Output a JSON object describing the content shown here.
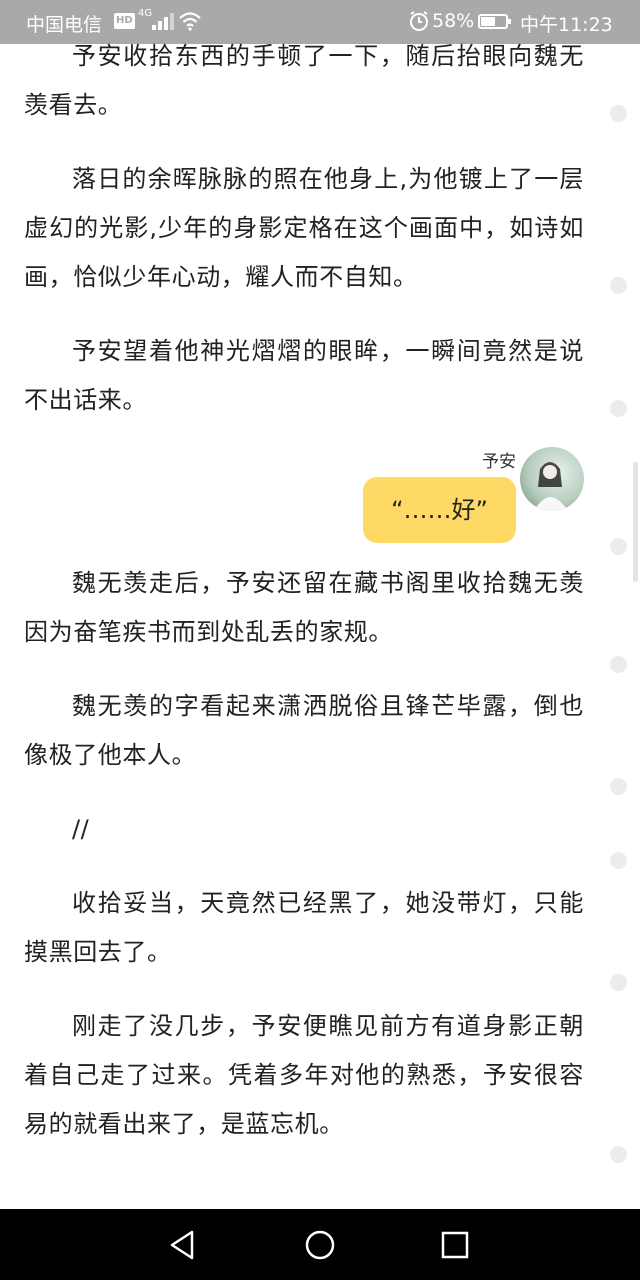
{
  "status_bar": {
    "carrier": "中国电信",
    "hd_badge": "HD",
    "network": "4G",
    "battery_percent": "58%",
    "battery_level": 0.58,
    "time": "中午11:23"
  },
  "paragraphs": {
    "p1": "予安收拾东西的手顿了一下，随后抬眼向魏无羡看去。",
    "p2": "落日的余晖脉脉的照在他身上,为他镀上了一层虚幻的光影,少年的身影定格在这个画面中，如诗如画，恰似少年心动，耀人而不自知。",
    "p3": "予安望着他神光熠熠的眼眸，一瞬间竟然是说不出话来。",
    "p4": "魏无羡走后，予安还留在藏书阁里收拾魏无羡因为奋笔疾书而到处乱丢的家规。",
    "p5": "魏无羡的字看起来潇洒脱俗且锋芒毕露，倒也像极了他本人。",
    "p6": "//",
    "p7": "收拾妥当，天竟然已经黑了，她没带灯，只能摸黑回去了。",
    "p8": "刚走了没几步，予安便瞧见前方有道身影正朝着自己走了过来。凭着多年对他的熟悉，予安很容易的就看出来了，是蓝忘机。"
  },
  "chat": {
    "speaker": "予安",
    "message": "“……好”"
  },
  "colors": {
    "bubble": "#ffd966",
    "status_bar": "#a9a9a9",
    "nav_bar": "#000000"
  },
  "nav": {
    "back_icon": "back-triangle-icon",
    "home_icon": "home-circle-icon",
    "recents_icon": "recents-square-icon"
  }
}
